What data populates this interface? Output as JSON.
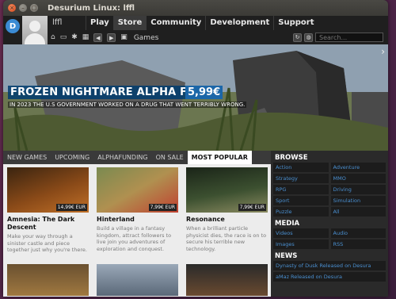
{
  "window": {
    "title": "Desurium Linux: lffl",
    "close_glyph": "×",
    "min_glyph": "–",
    "max_glyph": "□"
  },
  "header": {
    "logo_glyph": "D",
    "username": "lffl",
    "nav": [
      {
        "label": "Play",
        "active": false
      },
      {
        "label": "Store",
        "active": true
      },
      {
        "label": "Community",
        "active": false
      },
      {
        "label": "Development",
        "active": false
      },
      {
        "label": "Support",
        "active": false
      }
    ],
    "breadcrumb": "Games",
    "search_placeholder": "Search...",
    "icons": [
      "home-icon",
      "package-icon",
      "gear-icon",
      "grid-icon",
      "back-arrow-icon",
      "forward-arrow-icon",
      "refresh-icon",
      "globe-icon"
    ]
  },
  "hero": {
    "title": "FROZEN NIGHTMARE ALPHA FUND",
    "price": "5,99€",
    "subtitle": "IN 2023 THE U.S GOVERNMENT WORKED ON A DRUG THAT WENT TERRIBLY WRONG."
  },
  "tabs": [
    {
      "label": "NEW GAMES",
      "active": false
    },
    {
      "label": "UPCOMING",
      "active": false
    },
    {
      "label": "ALPHAFUNDING",
      "active": false
    },
    {
      "label": "ON SALE",
      "active": false
    },
    {
      "label": "MOST POPULAR",
      "active": true
    }
  ],
  "games": [
    {
      "name": "Amnesia: The Dark Descent",
      "price": "14,99€ EUR",
      "description": "Make your way through a sinister castle and piece together just why you're there.",
      "colors": [
        "#3a2410",
        "#8a4a18",
        "#c07028"
      ]
    },
    {
      "name": "Hinterland",
      "price": "7,99€ EUR",
      "description": "Build a village in a fantasy kingdom, attract followers to live join you adventures of exploration and conquest.",
      "colors": [
        "#7a8a50",
        "#c04030",
        "#e0a060"
      ]
    },
    {
      "name": "Resonance",
      "price": "7,99€ EUR",
      "description": "When a brilliant particle physicist dies, the race is on to secure his terrible new technology.",
      "colors": [
        "#1a2418",
        "#3c5030",
        "#8a8a60"
      ]
    }
  ],
  "sidebar": {
    "browse_title": "BROWSE",
    "browse": [
      "Action",
      "Adventure",
      "Strategy",
      "MMO",
      "RPG",
      "Driving",
      "Sport",
      "Simulation",
      "Puzzle",
      "All"
    ],
    "media_title": "MEDIA",
    "media": [
      "Videos",
      "Audio",
      "Images",
      "RSS"
    ],
    "news_title": "NEWS",
    "news": [
      "Dynasty of Dusk Released on Desura",
      "aMaz Released on Desura"
    ]
  },
  "colors": {
    "accent": "#1b66a8",
    "link": "#4a8fd0",
    "close_button": "#d4451a"
  }
}
